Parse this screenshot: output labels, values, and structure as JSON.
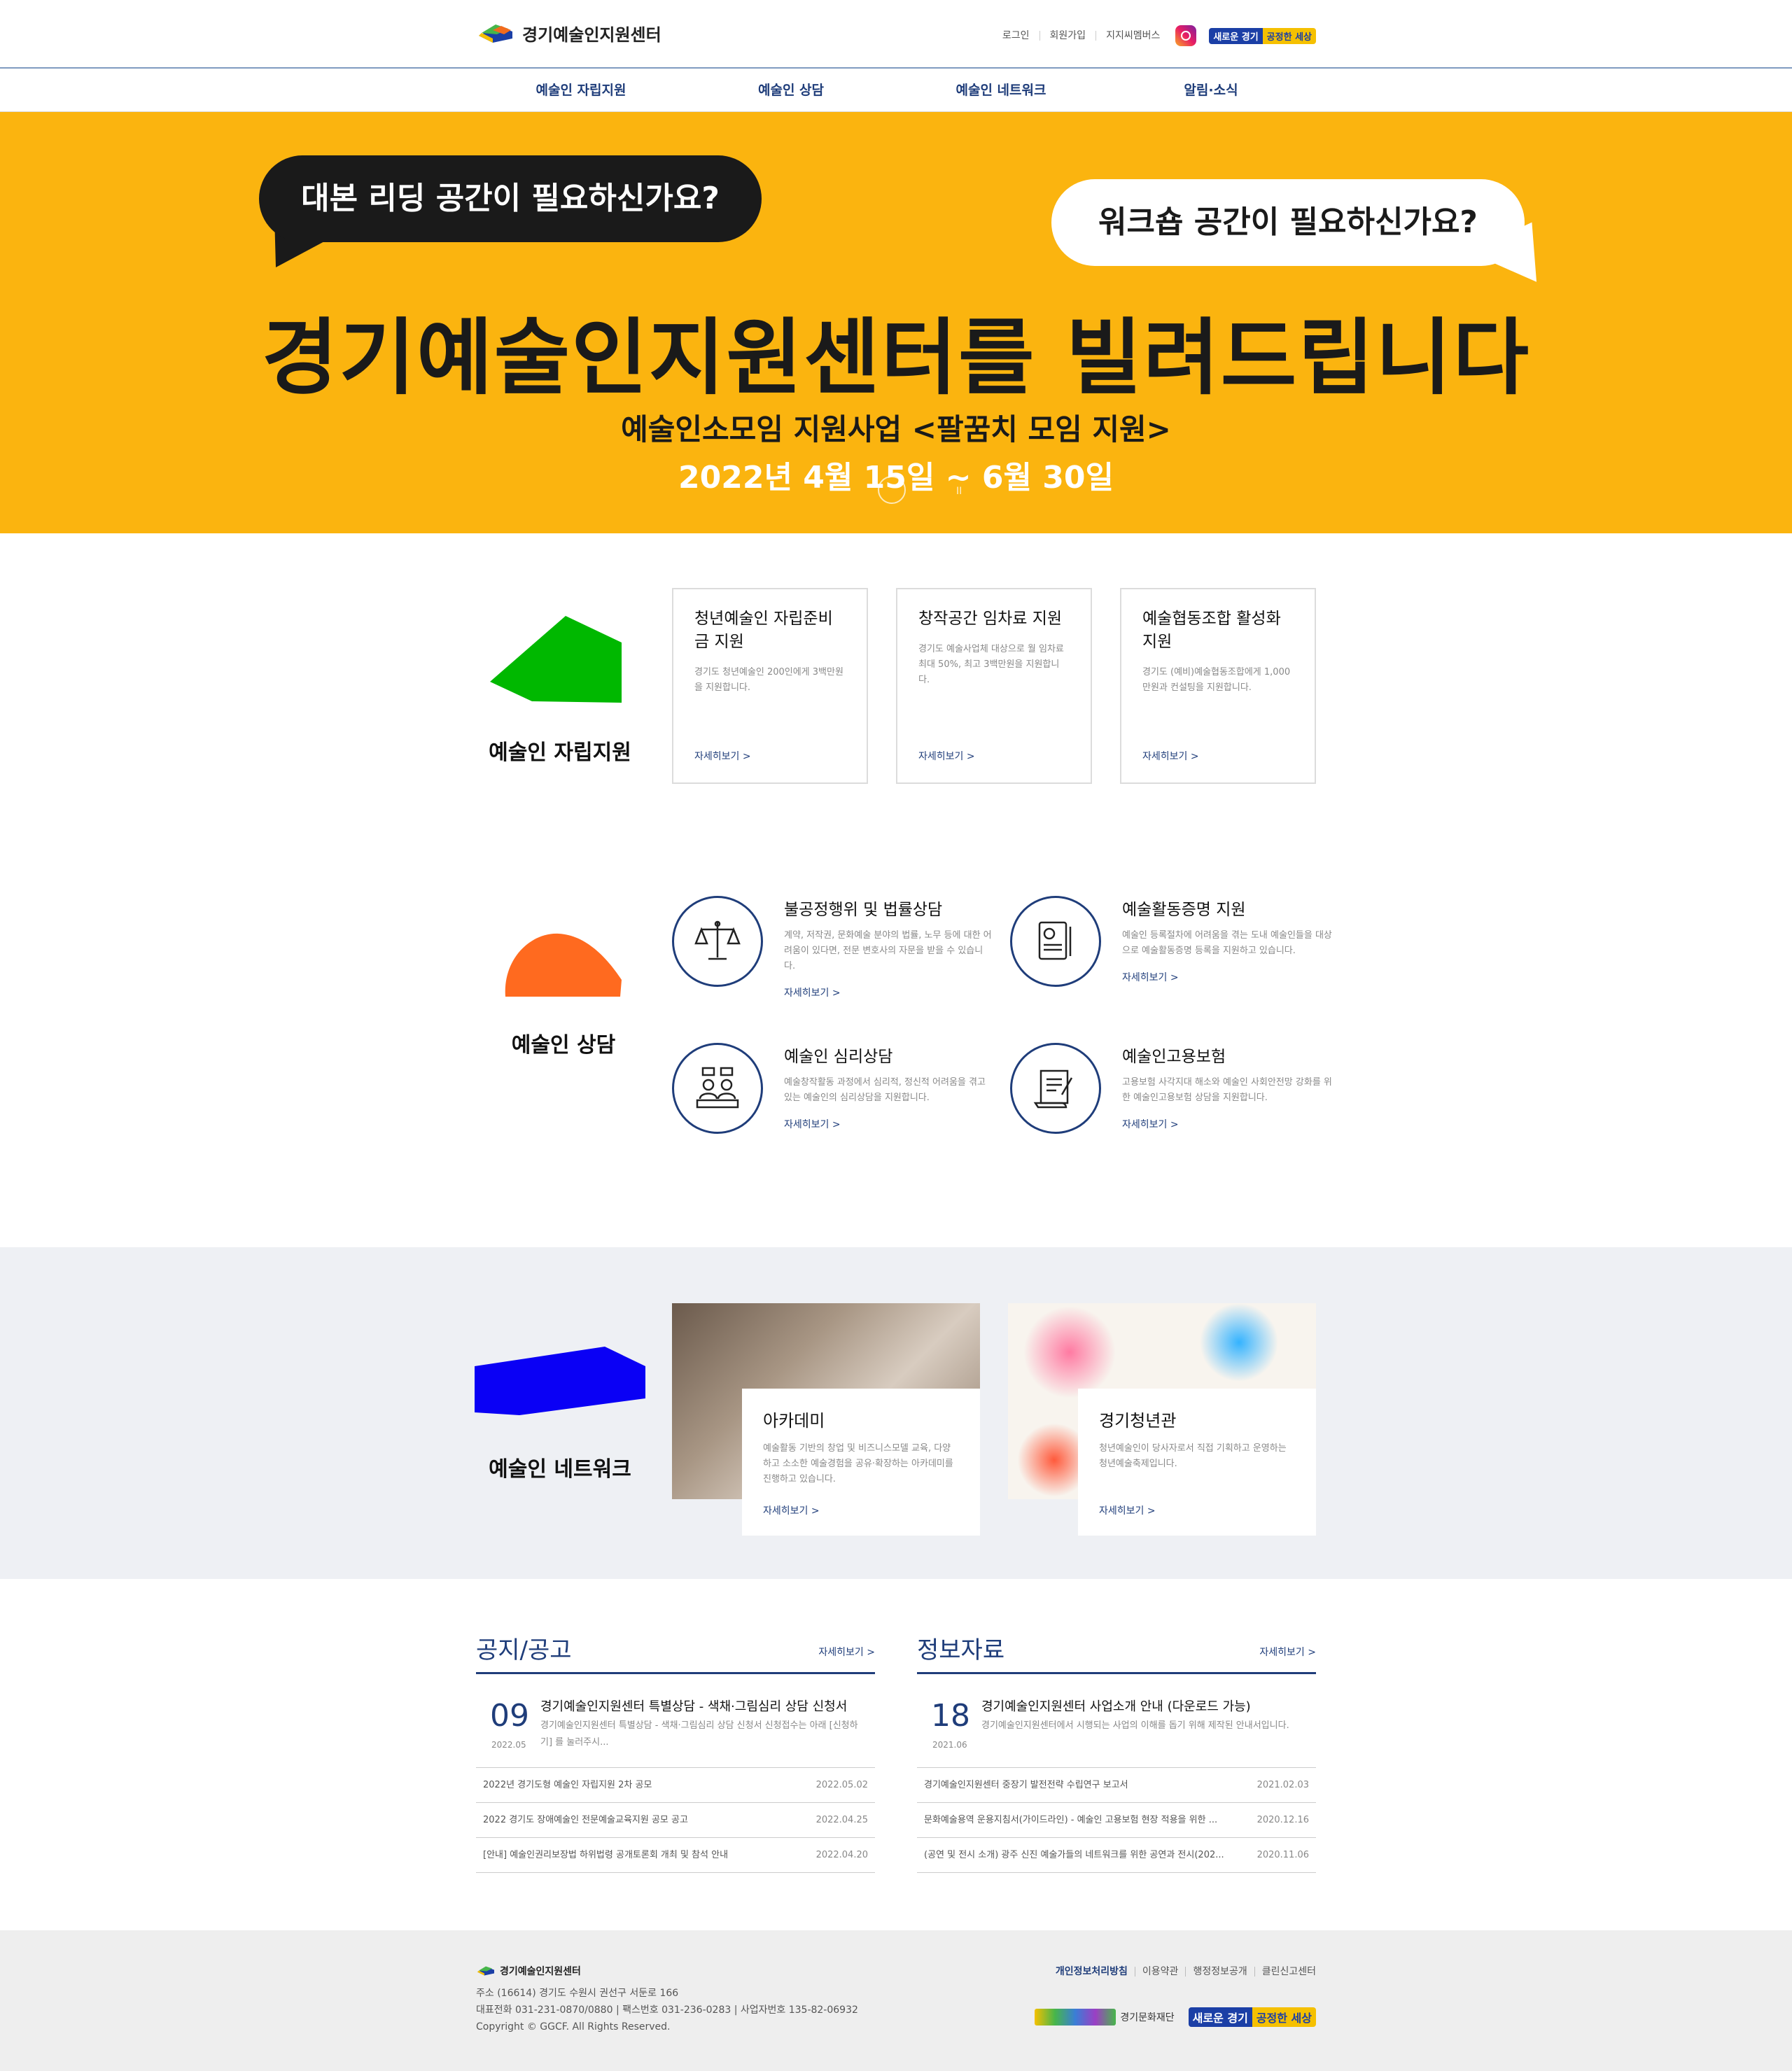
{
  "header": {
    "logo_text": "경기예술인지원센터",
    "util_links": [
      "로그인",
      "회원가입",
      "지지씨멤버스"
    ],
    "slogan": [
      "새로운 경기",
      "공정한 세상"
    ]
  },
  "nav": [
    "예술인 자립지원",
    "예술인 상담",
    "예술인 네트워크",
    "알림·소식"
  ],
  "hero": {
    "bubble_left": "대본 리딩 공간이 필요하신가요?",
    "bubble_right": "워크숍 공간이 필요하신가요?",
    "title": "경기예술인지원센터를 빌려드립니다",
    "subtitle": "예술인소모임 지원사업 <팔꿈치 모임 지원>",
    "date": "2022년 4월 15일 ~ 6월 30일",
    "pause": "II"
  },
  "self_support": {
    "label": "예술인 자립지원",
    "color": "#00b800",
    "cards": [
      {
        "title": "청년예술인 자립준비금 지원",
        "desc": "경기도 청년예술인 200인에게 3백만원을 지원합니다.",
        "more": "자세히보기 >"
      },
      {
        "title": "창작공간 임차료 지원",
        "desc": "경기도 예술사업체 대상으로 월 임차료 최대 50%, 최고 3백만원을 지원합니다.",
        "more": "자세히보기 >"
      },
      {
        "title": "예술협동조합 활성화 지원",
        "desc": "경기도 (예비)예술협동조합에게 1,000만원과 컨설팅을 지원합니다.",
        "more": "자세히보기 >"
      }
    ]
  },
  "consult": {
    "label": "예술인 상담",
    "color": "#ff6a1f",
    "items": [
      {
        "icon": "scales-icon",
        "title": "불공정행위 및 법률상담",
        "desc": "계약, 저작권, 문화예술 분야의 법률, 노무 등에 대한 어려움이 있다면, 전문 변호사의 자문을 받을 수 있습니다.",
        "more": "자세히보기 >"
      },
      {
        "icon": "certificate-icon",
        "title": "예술활동증명 지원",
        "desc": "예술인 등록절차에 어려움을 겪는 도내 예술인들을 대상으로 예술활동증명 등록을 지원하고 있습니다.",
        "more": "자세히보기 >"
      },
      {
        "icon": "counseling-icon",
        "title": "예술인 심리상담",
        "desc": "예술창작활동 과정에서 심리적, 정신적 어려움을 겪고 있는 예술인의 심리상담을 지원합니다.",
        "more": "자세히보기 >"
      },
      {
        "icon": "insurance-doc-icon",
        "title": "예술인고용보험",
        "desc": "고용보험 사각지대 해소와 예술인 사회안전망 강화를 위한 예술인고용보험 상담을 지원합니다.",
        "more": "자세히보기 >"
      }
    ]
  },
  "network": {
    "label": "예술인 네트워크",
    "color": "#0a00f5",
    "items": [
      {
        "title": "아카데미",
        "desc": "예술활동 기반의 창업 및 비즈니스모델 교육, 다양하고 소소한 예술경험을 공유·확장하는 아카데미를 진행하고 있습니다.",
        "more": "자세히보기 >"
      },
      {
        "title": "경기청년관",
        "desc": "청년예술인이 당사자로서 직접 기획하고 운영하는 청년예술축제입니다.",
        "more": "자세히보기 >"
      }
    ]
  },
  "notice": {
    "title": "공지/공고",
    "more": "자세히보기 >",
    "featured": {
      "day": "09",
      "ym": "2022.05",
      "title": "경기예술인지원센터 특별상담 - 색채·그림심리 상담 신청서",
      "desc": "경기예술인지원센터 특별상담 - 색채·그림심리 상담 신청서 신청접수는 아래 [신청하기] 를 눌러주시..."
    },
    "rows": [
      {
        "title": "2022년 경기도형 예술인 자립지원 2차 공모",
        "date": "2022.05.02"
      },
      {
        "title": "2022 경기도 장애예술인 전문예술교육지원 공모 공고",
        "date": "2022.04.25"
      },
      {
        "title": "[안내] 예술인권리보장법 하위법령 공개토론회 개최 및 참석 안내",
        "date": "2022.04.20"
      }
    ]
  },
  "info": {
    "title": "정보자료",
    "more": "자세히보기 >",
    "featured": {
      "day": "18",
      "ym": "2021.06",
      "title": "경기예술인지원센터 사업소개 안내 (다운로드 가능)",
      "desc": "경기예술인지원센터에서 시행되는 사업의 이해를 돕기 위해 제작된 안내서입니다."
    },
    "rows": [
      {
        "title": "경기예술인지원센터 중장기 발전전략 수립연구 보고서",
        "date": "2021.02.03"
      },
      {
        "title": "문화예술용역 운용지침서(가이드라인) - 예술인 고용보험 현장 적용을 위한 ...",
        "date": "2020.12.16"
      },
      {
        "title": "(공연 및 전시 소개) 광주 신진 예술가들의 네트워크를 위한 공연과 전시(202...",
        "date": "2020.11.06"
      }
    ]
  },
  "footer": {
    "logo_text": "경기예술인지원센터",
    "address": "주소 (16614) 경기도 수원시 권선구 서둔로 166",
    "contact": "대표전화 031-231-0870/0880  |  팩스번호 031-236-0283  |  사업자번호 135-82-06932",
    "copyright": "Copyright © GGCF. All Rights Reserved.",
    "links": [
      "개인정보처리방침",
      "이용약관",
      "행정정보공개",
      "클린신고센터"
    ],
    "foundation": "경기문화재단",
    "slogan": [
      "새로운 경기",
      "공정한 세상"
    ]
  }
}
